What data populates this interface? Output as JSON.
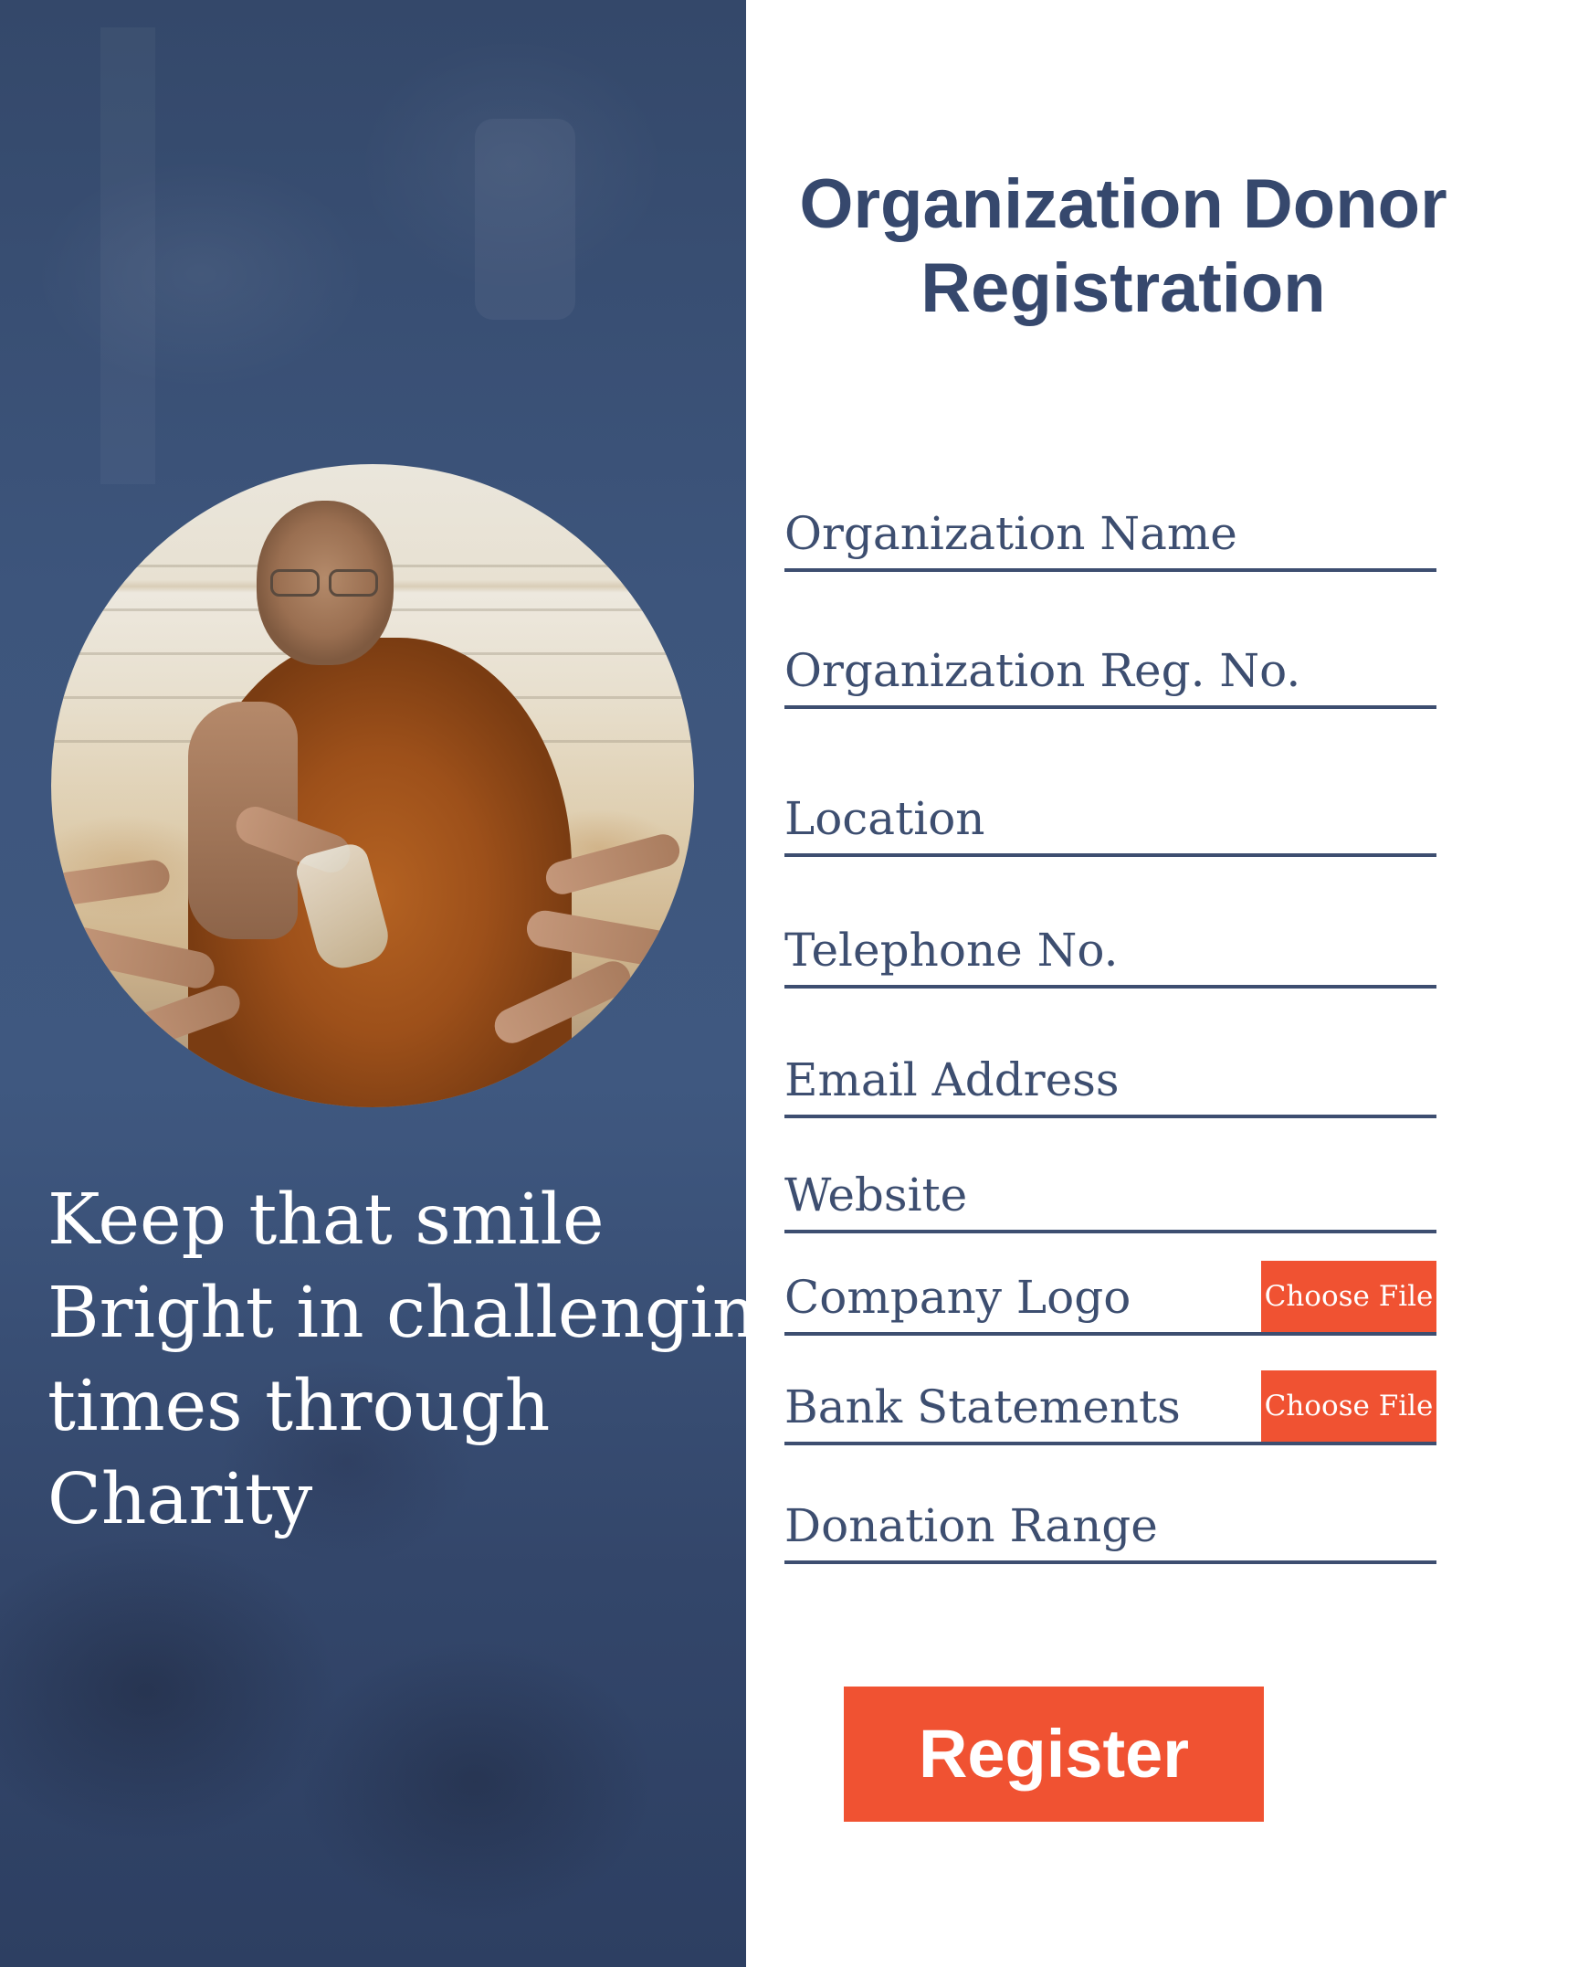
{
  "tagline": {
    "lines": [
      "Keep that smile",
      "Bright in challenging",
      "times through",
      "Charity"
    ]
  },
  "form": {
    "title_lines": [
      "Organization Donor",
      "Registration"
    ],
    "fields": [
      {
        "label": "Organization Name"
      },
      {
        "label": "Organization Reg. No."
      },
      {
        "label": "Location"
      },
      {
        "label": "Telephone No."
      },
      {
        "label": "Email Address"
      },
      {
        "label": "Website"
      },
      {
        "label": "Company Logo",
        "button": "Choose File"
      },
      {
        "label": "Bank Statements",
        "button": "Choose File"
      },
      {
        "label": "Donation Range"
      }
    ],
    "register_label": "Register"
  },
  "colors": {
    "panel_blue": "#3a5276",
    "text_navy": "#36486d",
    "accent_orange": "#f05232",
    "background": "#ffffff"
  }
}
